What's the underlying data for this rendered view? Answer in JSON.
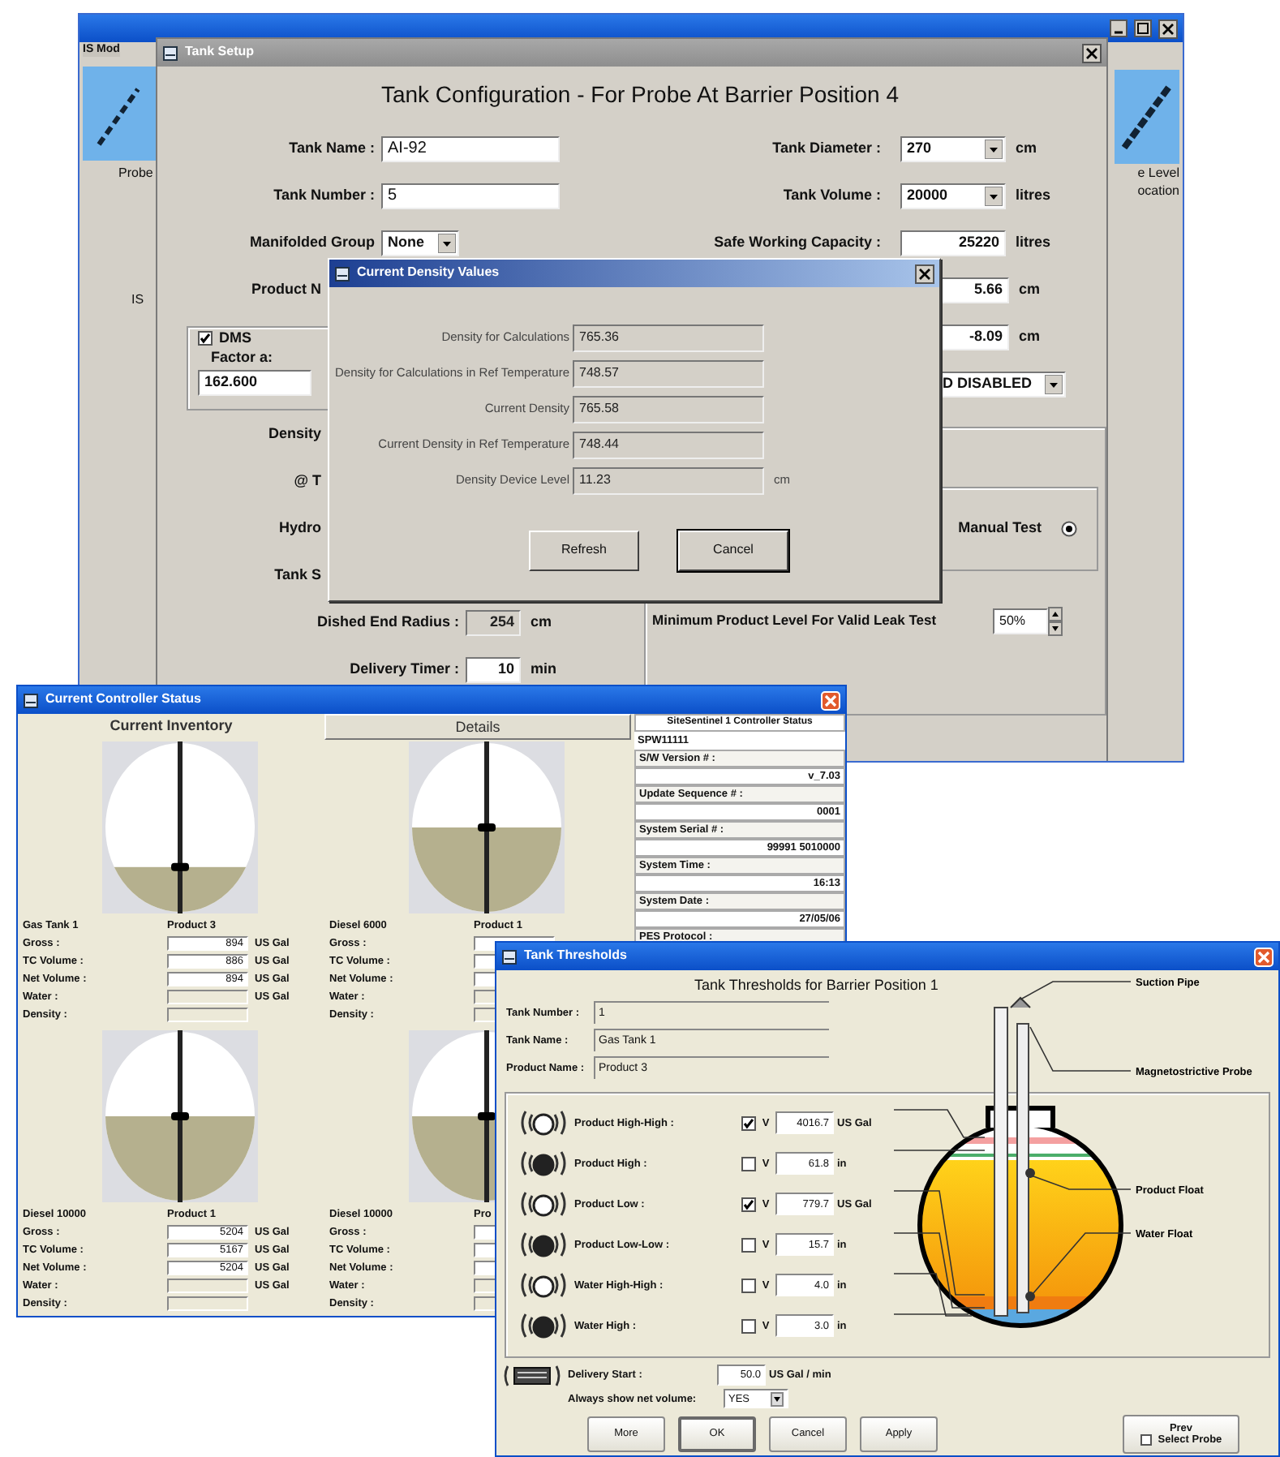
{
  "main_window": {
    "menu_fragment": "IS Mod",
    "left_labels": [
      "Probe",
      "IS"
    ],
    "right_labels": [
      "e Level",
      "ocation"
    ]
  },
  "tank_setup": {
    "title": "Tank Setup",
    "heading": "Tank Configuration - For Probe At Barrier Position 4",
    "left_fields": [
      {
        "label": "Tank Name :",
        "value": "AI-92",
        "kind": "text"
      },
      {
        "label": "Tank Number :",
        "value": "5",
        "kind": "text"
      },
      {
        "label": "Manifolded Group",
        "value": "None",
        "kind": "select"
      },
      {
        "label": "Product N",
        "kind": "cut"
      }
    ],
    "dms": {
      "label": "DMS",
      "checked": true,
      "factor_label": "Factor a:",
      "factor_value": "162.600"
    },
    "cut_labels": [
      "Density",
      "@ T",
      "Hydro",
      "Tank S"
    ],
    "lower_fields": [
      {
        "label": "Dished End Radius :",
        "value": "254",
        "unit": "cm",
        "disabled": true
      },
      {
        "label": "Delivery Timer :",
        "value": "10",
        "unit": "min",
        "disabled": false
      }
    ],
    "right_fields": [
      {
        "label": "Tank Diameter :",
        "value": "270",
        "unit": "cm",
        "kind": "select"
      },
      {
        "label": "Tank Volume :",
        "value": "20000",
        "unit": "litres",
        "kind": "select"
      },
      {
        "label": "Safe Working Capacity :",
        "value": "25220",
        "unit": "litres",
        "kind": "text"
      },
      {
        "value": "5.66",
        "unit": "cm",
        "kind": "text"
      },
      {
        "value": "-8.09",
        "unit": "cm",
        "kind": "text"
      },
      {
        "value": "D DISABLED",
        "kind": "select"
      }
    ],
    "manual_test": {
      "label": "Manual Test",
      "selected": true
    },
    "min_level": {
      "label": "Minimum Product Level For Valid Leak Test",
      "value": "50%"
    }
  },
  "density_dialog": {
    "title": "Current Density Values",
    "rows": [
      {
        "label": "Density for Calculations",
        "value": "765.36"
      },
      {
        "label": "Density for Calculations in Ref Temperature",
        "value": "748.57"
      },
      {
        "label": "Current Density",
        "value": "765.58"
      },
      {
        "label": "Current Density in Ref Temperature",
        "value": "748.44"
      },
      {
        "label": "Density Device Level",
        "value": "11.23",
        "unit": "cm"
      }
    ],
    "buttons": [
      {
        "label": "Refresh",
        "default": false
      },
      {
        "label": "Cancel",
        "default": true
      }
    ]
  },
  "controller_status": {
    "title": "Current Controller Status",
    "tabs": [
      {
        "label": "Current Inventory",
        "selected": true
      },
      {
        "label": "Details",
        "selected": false
      }
    ],
    "tanks": [
      {
        "name": "Gas Tank 1",
        "product": "Product 3",
        "level": 0.27,
        "rows": [
          {
            "label": "Gross :",
            "value": "894",
            "unit": "US Gal"
          },
          {
            "label": "TC Volume :",
            "value": "886",
            "unit": "US Gal"
          },
          {
            "label": "Net Volume :",
            "value": "894",
            "unit": "US Gal"
          },
          {
            "label": "Water :",
            "unit": "US Gal",
            "disabled": true
          },
          {
            "label": "Density :",
            "disabled": true
          }
        ]
      },
      {
        "name": "Diesel 6000",
        "product": "Product 1",
        "level": 0.5,
        "rows": [
          {
            "label": "Gross :"
          },
          {
            "label": "TC Volume :"
          },
          {
            "label": "Net Volume :"
          },
          {
            "label": "Water :",
            "disabled": true
          },
          {
            "label": "Density :",
            "disabled": true
          }
        ]
      },
      {
        "name": "Diesel 10000",
        "product": "Product 1",
        "level": 0.5,
        "rows": [
          {
            "label": "Gross :",
            "value": "5204",
            "unit": "US Gal"
          },
          {
            "label": "TC Volume :",
            "value": "5167",
            "unit": "US Gal"
          },
          {
            "label": "Net Volume :",
            "value": "5204",
            "unit": "US Gal"
          },
          {
            "label": "Water :",
            "unit": "US Gal",
            "disabled": true
          },
          {
            "label": "Density :",
            "disabled": true
          }
        ]
      },
      {
        "name": "Diesel 10000",
        "product": "Pro",
        "level": 0.5,
        "rows": [
          {
            "label": "Gross :"
          },
          {
            "label": "TC Volume :"
          },
          {
            "label": "Net Volume :"
          },
          {
            "label": "Water :",
            "disabled": true
          },
          {
            "label": "Density :",
            "disabled": true
          }
        ]
      }
    ],
    "status_panel": {
      "heading": "SiteSentinel 1 Controller Status",
      "site": "SPW11111",
      "items": [
        {
          "label": "S/W Version # :",
          "value": "v_7.03"
        },
        {
          "label": "Update Sequence # :",
          "value": "0001"
        },
        {
          "label": "System Serial # :",
          "value": "99991 5010000"
        },
        {
          "label": "System Time :",
          "value": "16:13"
        },
        {
          "label": "System Date :",
          "value": "27/05/06"
        }
      ],
      "cut_label": "PES Protocol :"
    }
  },
  "thresholds": {
    "title": "Tank Thresholds",
    "heading": "Tank Thresholds for Barrier Position 1",
    "info": [
      {
        "label": "Tank Number :",
        "value": "1"
      },
      {
        "label": "Tank Name :",
        "value": "Gas Tank 1"
      },
      {
        "label": "Product Name :",
        "value": "Product 3"
      }
    ],
    "rows": [
      {
        "label": "Product High-High :",
        "checked": true,
        "flag": "V",
        "value": "4016.7",
        "unit": "US Gal"
      },
      {
        "label": "Product High :",
        "checked": false,
        "flag": "V",
        "value": "61.8",
        "unit": "in"
      },
      {
        "label": "Product Low :",
        "checked": true,
        "flag": "V",
        "value": "779.7",
        "unit": "US Gal"
      },
      {
        "label": "Product Low-Low :",
        "checked": false,
        "flag": "V",
        "value": "15.7",
        "unit": "in"
      },
      {
        "label": "Water High-High :",
        "checked": false,
        "flag": "V",
        "value": "4.0",
        "unit": "in"
      },
      {
        "label": "Water High :",
        "checked": false,
        "flag": "V",
        "value": "3.0",
        "unit": "in"
      }
    ],
    "diagram_labels": [
      "Suction Pipe",
      "Magnetostrictive Probe",
      "Product Float",
      "Water Float"
    ],
    "delivery": {
      "label": "Delivery Start :",
      "value": "50.0",
      "unit": "US Gal / min"
    },
    "net_volume": {
      "label": "Always show net volume:",
      "value": "YES"
    },
    "buttons": [
      {
        "label": "More",
        "default": false
      },
      {
        "label": "OK",
        "default": true
      },
      {
        "label": "Cancel",
        "default": false
      },
      {
        "label": "Apply",
        "default": false
      }
    ],
    "probe_box": {
      "label": "Prev",
      "checkbox_label": "Select Probe",
      "checked": false
    }
  }
}
